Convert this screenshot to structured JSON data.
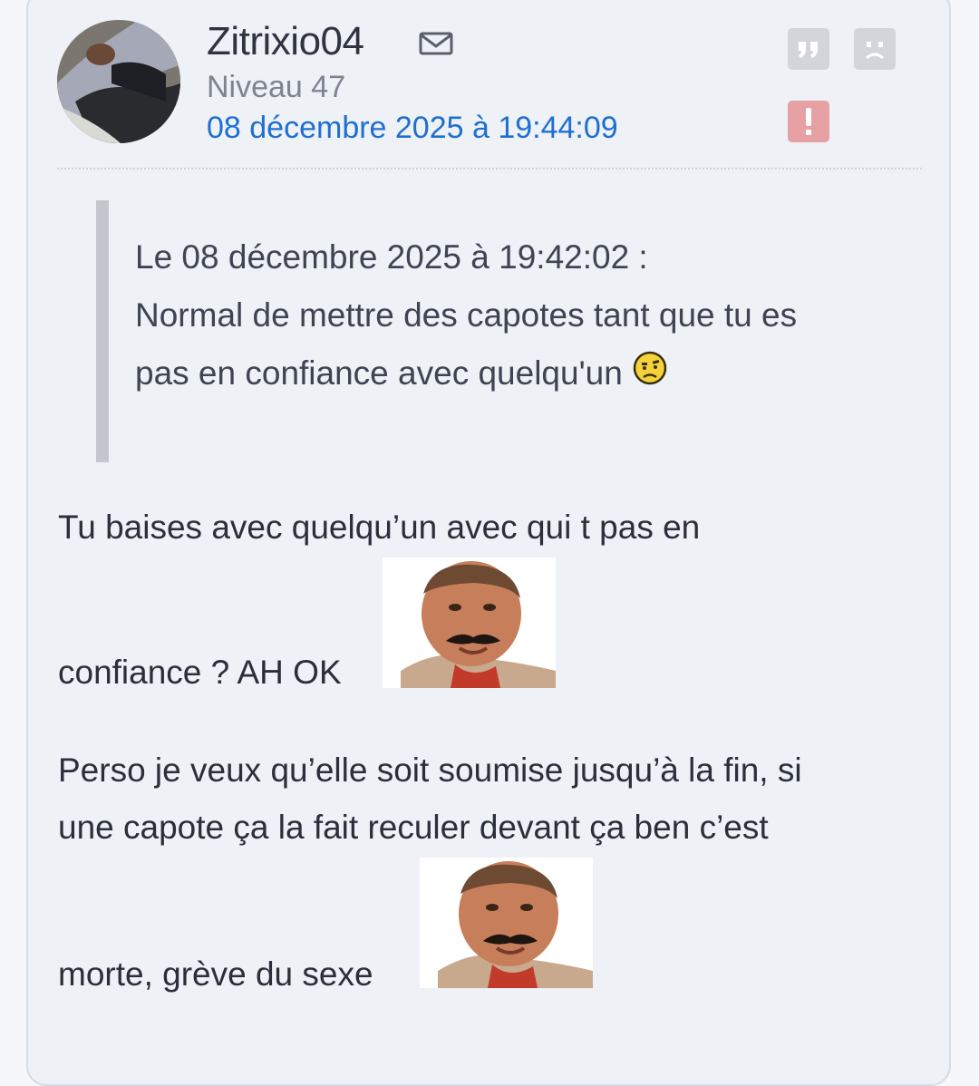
{
  "post": {
    "username": "Zitrixio04",
    "level": "Niveau 47",
    "date": "08 décembre 2025 à 19:44:09",
    "icons": {
      "mail": "mail-icon",
      "quote": "quote-icon",
      "sad": "sad-face-icon",
      "report": "exclamation-icon",
      "avatar": "avatar"
    },
    "quote": {
      "header": "Le 08 décembre 2025 à 19:42:02 :",
      "line1": "Normal de mettre des capotes tant que tu es",
      "line2": "pas en confiance avec quelqu'un"
    },
    "body": {
      "line1": "Tu baises avec quelqu’un avec qui t pas en",
      "line2": "confiance ? AH OK",
      "line3": "Perso je veux qu’elle soit soumise jusqu’à la fin, si",
      "line4": "une capote ça la fait reculer devant ça ben c’est",
      "line5": "morte, grève du sexe"
    },
    "colors": {
      "date_link": "#1f6fd1",
      "report_button": "#e7a0a4",
      "card_background": "#eef1f6"
    }
  }
}
